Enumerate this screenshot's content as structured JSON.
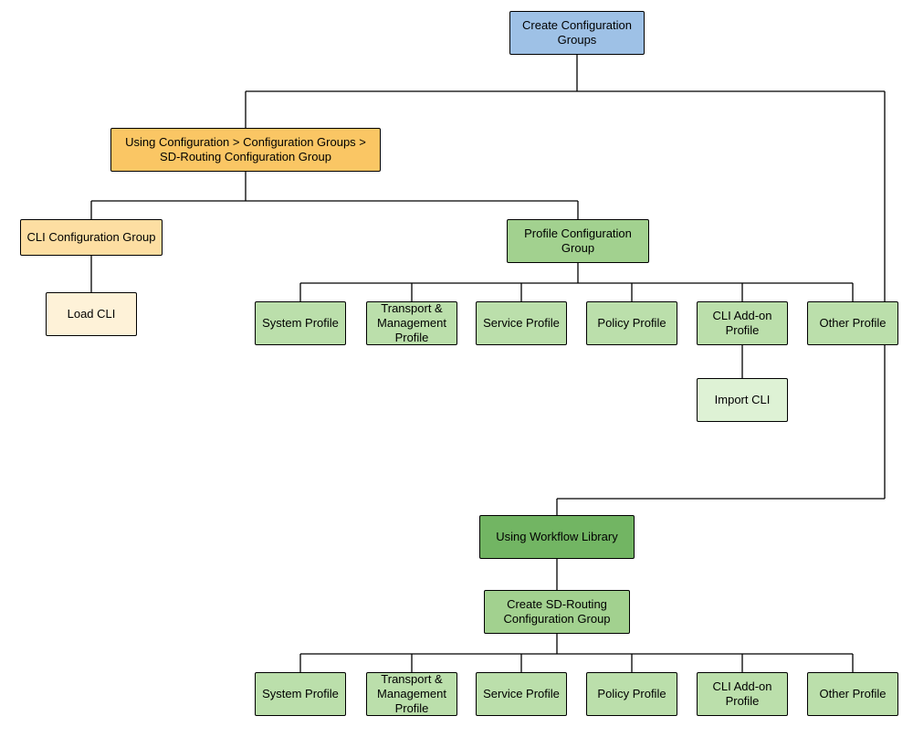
{
  "chart_data": {
    "type": "tree",
    "root": {
      "id": "create-config-groups",
      "label": "Create Configuration Groups",
      "children": [
        {
          "id": "using-config-groups",
          "label": "Using Configuration > Configuration Groups > SD-Routing Configuration Group",
          "children": [
            {
              "id": "cli-config-group",
              "label": "CLI  Configuration Group",
              "children": [
                {
                  "id": "load-cli",
                  "label": "Load CLI"
                }
              ]
            },
            {
              "id": "profile-config-group",
              "label": "Profile Configuration Group",
              "children": [
                {
                  "id": "system-profile-1",
                  "label": "System Profile"
                },
                {
                  "id": "transport-mgmt-profile-1",
                  "label": "Transport & Management Profile"
                },
                {
                  "id": "service-profile-1",
                  "label": "Service Profile"
                },
                {
                  "id": "policy-profile-1",
                  "label": "Policy Profile"
                },
                {
                  "id": "cli-addon-profile-1",
                  "label": "CLI Add-on Profile",
                  "children": [
                    {
                      "id": "import-cli",
                      "label": "Import CLI"
                    }
                  ]
                },
                {
                  "id": "other-profile-1",
                  "label": "Other Profile"
                }
              ]
            }
          ]
        },
        {
          "id": "using-workflow-library",
          "label": "Using Workflow Library",
          "children": [
            {
              "id": "create-sdr-config-group",
              "label": "Create SD-Routing Configuration Group",
              "children": [
                {
                  "id": "system-profile-2",
                  "label": "System Profile"
                },
                {
                  "id": "transport-mgmt-profile-2",
                  "label": "Transport & Management Profile"
                },
                {
                  "id": "service-profile-2",
                  "label": "Service Profile"
                },
                {
                  "id": "policy-profile-2",
                  "label": "Policy Profile"
                },
                {
                  "id": "cli-addon-profile-2",
                  "label": "CLI Add-on Profile"
                },
                {
                  "id": "other-profile-2",
                  "label": "Other Profile"
                }
              ]
            }
          ]
        }
      ]
    }
  },
  "colors": {
    "blue": "#9ec1e6",
    "orange_dark": "#fac664",
    "orange_light": "#fddea2",
    "orange_pale": "#fef2d8",
    "green_dark": "#72b563",
    "green_med": "#a2d18f",
    "green_light": "#bbdfab",
    "green_pale": "#def2d5",
    "line": "#000000"
  },
  "labels": {
    "root": "Create Configuration Groups",
    "using_config": "Using Configuration > Configuration Groups > SD-Routing Configuration Group",
    "cli_config_group": "CLI  Configuration Group",
    "load_cli": "Load CLI",
    "profile_config_group": "Profile Configuration Group",
    "system_profile": "System Profile",
    "transport_mgmt_profile": "Transport & Management Profile",
    "service_profile": "Service Profile",
    "policy_profile": "Policy Profile",
    "cli_addon_profile": "CLI Add-on Profile",
    "other_profile": "Other Profile",
    "import_cli": "Import CLI",
    "using_workflow_library": "Using Workflow Library",
    "create_sdr_group": "Create SD-Routing Configuration Group"
  }
}
